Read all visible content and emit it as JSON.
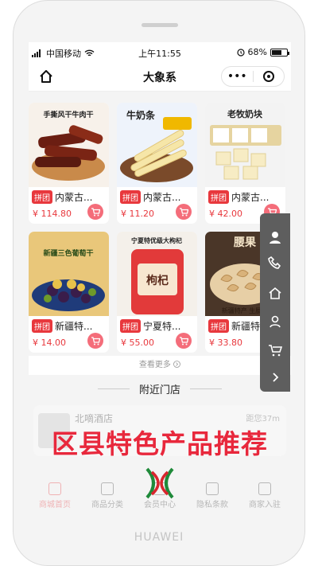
{
  "status": {
    "carrier": "中国移动",
    "time": "上午11:55",
    "battery": "68%",
    "battery_level": 0.68
  },
  "nav": {
    "title": "大象系",
    "more_label": "•••"
  },
  "products": [
    {
      "tag": "拼团",
      "name": "内蒙古...",
      "price": "¥ 114.80",
      "img_text": "手撕风干牛肉干"
    },
    {
      "tag": "拼团",
      "name": "内蒙古...",
      "price": "¥ 11.20",
      "img_text": "牛奶条"
    },
    {
      "tag": "拼团",
      "name": "内蒙古...",
      "price": "¥ 42.00",
      "img_text": "老牧奶块"
    },
    {
      "tag": "拼团",
      "name": "新疆特...",
      "price": "¥ 14.00",
      "img_text": "新疆三色葡萄干"
    },
    {
      "tag": "拼团",
      "name": "宁夏特...",
      "price": "¥ 55.00",
      "img_text": "宁夏特优级大枸杞"
    },
    {
      "tag": "拼团",
      "name": "新疆特...",
      "price": "¥ 33.80",
      "img_text": "新疆特产 生腰果"
    }
  ],
  "view_more": "查看更多",
  "nearby_title": "附近门店",
  "store": {
    "name": "北嘀酒店",
    "distance": "距您37m"
  },
  "banner": "区县特色产品推荐",
  "tabs": [
    {
      "label": "商城首页",
      "icon": "home-icon",
      "active": true
    },
    {
      "label": "商品分类",
      "icon": "category-icon",
      "active": false
    },
    {
      "label": "会员中心",
      "icon": "member-icon",
      "active": false
    },
    {
      "label": "隐私条款",
      "icon": "privacy-icon",
      "active": false
    },
    {
      "label": "商家入驻",
      "icon": "merchant-icon",
      "active": false
    }
  ],
  "device_brand": "HUAWEI",
  "colors": {
    "accent": "#e8383d",
    "panel": "#5e5e5e"
  }
}
